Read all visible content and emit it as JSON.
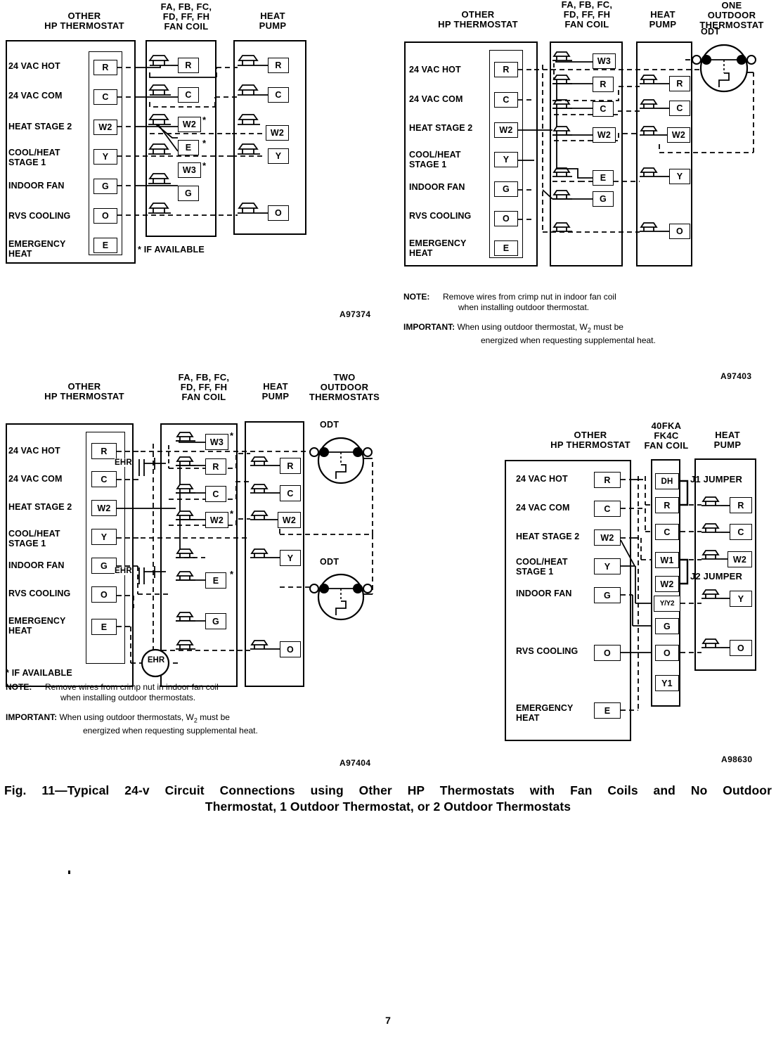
{
  "page": {
    "number": "7",
    "figure_caption_line1": "Fig. 11—Typical 24-v Circuit Connections using Other HP Thermostats with Fan Coils and No Outdoor",
    "figure_caption_line2": "Thermostat, 1 Outdoor Thermostat, or 2 Outdoor Thermostats"
  },
  "thermostat_rows": [
    "24 VAC HOT",
    "24 VAC COM",
    "HEAT STAGE 2",
    "COOL/HEAT\nSTAGE 1",
    "INDOOR FAN",
    "RVS COOLING",
    "EMERGENCY\nHEAT"
  ],
  "thermostat_terminals": [
    "R",
    "C",
    "W2",
    "Y",
    "G",
    "O",
    "E"
  ],
  "diagram1": {
    "ref": "A97374",
    "headers": {
      "thermostat": "OTHER\nHP THERMOSTAT",
      "fancoil": "FA, FB, FC,\nFD, FF, FH\nFAN COIL",
      "heatpump": "HEAT\nPUMP"
    },
    "fancoil_terminals": [
      {
        "label": "R",
        "star": false
      },
      {
        "label": "C",
        "star": false
      },
      {
        "label": "W2",
        "star": true
      },
      {
        "label": "E",
        "star": true
      },
      {
        "label": "W3",
        "star": true
      },
      {
        "label": "G",
        "star": false
      }
    ],
    "heatpump_terminals": [
      "R",
      "C",
      "W2",
      "Y",
      "O"
    ],
    "footnote": "* IF AVAILABLE"
  },
  "diagram2": {
    "ref": "A97403",
    "headers": {
      "thermostat": "OTHER\nHP THERMOSTAT",
      "fancoil": "FA, FB, FC,\nFD, FF, FH\nFAN COIL",
      "heatpump": "HEAT\nPUMP",
      "outdoor": "ONE\nOUTDOOR\nTHERMOSTAT"
    },
    "fancoil_terminals": [
      "W3",
      "R",
      "C",
      "W2",
      "E",
      "G"
    ],
    "heatpump_terminals": [
      "R",
      "C",
      "W2",
      "Y",
      "O"
    ],
    "odt_label": "ODT",
    "note_label": "NOTE:",
    "note_line1": "Remove wires from crimp nut in indoor fan coil",
    "note_line2": "when installing outdoor thermostat.",
    "important_label": "IMPORTANT:",
    "important_line1_a": "When using outdoor thermostat, W",
    "important_line1_sub": "2",
    "important_line1_b": " must be",
    "important_line2": "energized when requesting supplemental heat."
  },
  "diagram3": {
    "ref": "A97404",
    "headers": {
      "thermostat": "OTHER\nHP THERMOSTAT",
      "fancoil": "FA, FB, FC,\nFD, FF, FH\nFAN COIL",
      "heatpump": "HEAT\nPUMP",
      "outdoor": "TWO\nOUTDOOR\nTHERMOSTATS"
    },
    "fancoil_terminals": [
      {
        "label": "W3",
        "star": true
      },
      {
        "label": "R",
        "star": false
      },
      {
        "label": "C",
        "star": false
      },
      {
        "label": "W2",
        "star": true
      },
      {
        "label": "E",
        "star": true
      },
      {
        "label": "G",
        "star": false
      }
    ],
    "heatpump_terminals": [
      "R",
      "C",
      "W2",
      "Y",
      "O"
    ],
    "odt_label": "ODT",
    "relay_label": "EHR",
    "contact_label": "EHR",
    "footnote": "* IF AVAILABLE",
    "note_label": "NOTE:",
    "note_line1": "Remove wires from crimp nut in indoor fan coil",
    "note_line2": "when installing outdoor thermostats.",
    "important_label": "IMPORTANT:",
    "important_line1_a": "When using outdoor thermostats, W",
    "important_line1_sub": "2",
    "important_line1_b": " must be",
    "important_line2": "energized when requesting supplemental heat."
  },
  "diagram4": {
    "ref": "A98630",
    "headers": {
      "thermostat": "OTHER\nHP THERMOSTAT",
      "fancoil": "40FKA\nFK4C\nFAN COIL",
      "heatpump": "HEAT\nPUMP"
    },
    "fancoil_terminals": [
      "DH",
      "R",
      "C",
      "W1",
      "W2",
      "Y/Y2",
      "G",
      "O",
      "Y1"
    ],
    "heatpump_terminals": [
      "R",
      "C",
      "W2",
      "Y",
      "O"
    ],
    "jumper1": "J1 JUMPER",
    "jumper2": "J2 JUMPER"
  }
}
